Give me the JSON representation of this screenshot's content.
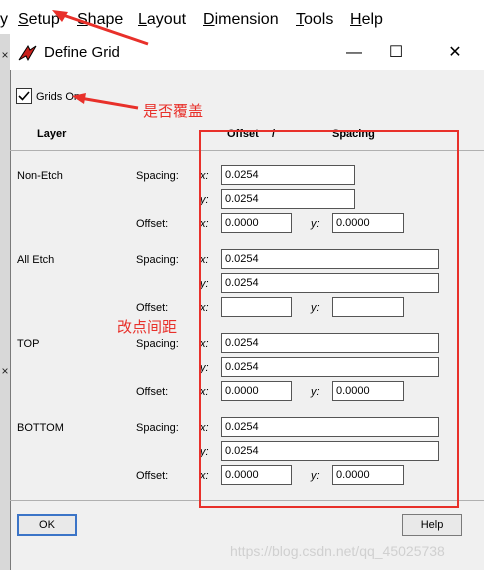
{
  "menubar": {
    "items": [
      {
        "label": "Setup",
        "accel": "S",
        "rest": "etup"
      },
      {
        "label": "Shape",
        "accel": "S",
        "rest": "hape"
      },
      {
        "label": "Layout",
        "accel": "L",
        "rest": "ayout"
      },
      {
        "label": "Dimension",
        "accel": "D",
        "rest": "imension"
      },
      {
        "label": "Tools",
        "accel": "T",
        "rest": "ools"
      },
      {
        "label": "Help",
        "accel": "H",
        "rest": "elp"
      }
    ],
    "left_glyph": "y"
  },
  "dialog": {
    "title": "Define Grid",
    "grids_on_label": "Grids On",
    "grids_on_checked": true,
    "headers": {
      "layer": "Layer",
      "offset": "Offset",
      "slash": "/",
      "spacing": "Spacing"
    },
    "layers": [
      {
        "name": "Non-Etch",
        "spacing_label": "Spacing:",
        "offset_label": "Offset:",
        "spacing_x": "0.0254",
        "spacing_y": "0.0254",
        "offset_x": "0.0000",
        "offset_y": "0.0000"
      },
      {
        "name": "All Etch",
        "spacing_label": "Spacing:",
        "offset_label": "Offset:",
        "spacing_x": "0.0254",
        "spacing_y": "0.0254",
        "offset_x": "",
        "offset_y": ""
      },
      {
        "name": "TOP",
        "spacing_label": "Spacing:",
        "offset_label": "Offset:",
        "spacing_x": "0.0254",
        "spacing_y": "0.0254",
        "offset_x": "0.0000",
        "offset_y": "0.0000"
      },
      {
        "name": "BOTTOM",
        "spacing_label": "Spacing:",
        "offset_label": "Offset:",
        "spacing_x": "0.0254",
        "spacing_y": "0.0254",
        "offset_x": "0.0000",
        "offset_y": "0.0000"
      }
    ],
    "axis_x": "x:",
    "axis_y": "y:",
    "ok_label": "OK",
    "help_label": "Help"
  },
  "annotations": {
    "grids_on_note": "是否覆盖",
    "spacing_note": "改点间距",
    "color": "#e8302a"
  },
  "watermark": "https://blog.csdn.net/qq_45025738"
}
